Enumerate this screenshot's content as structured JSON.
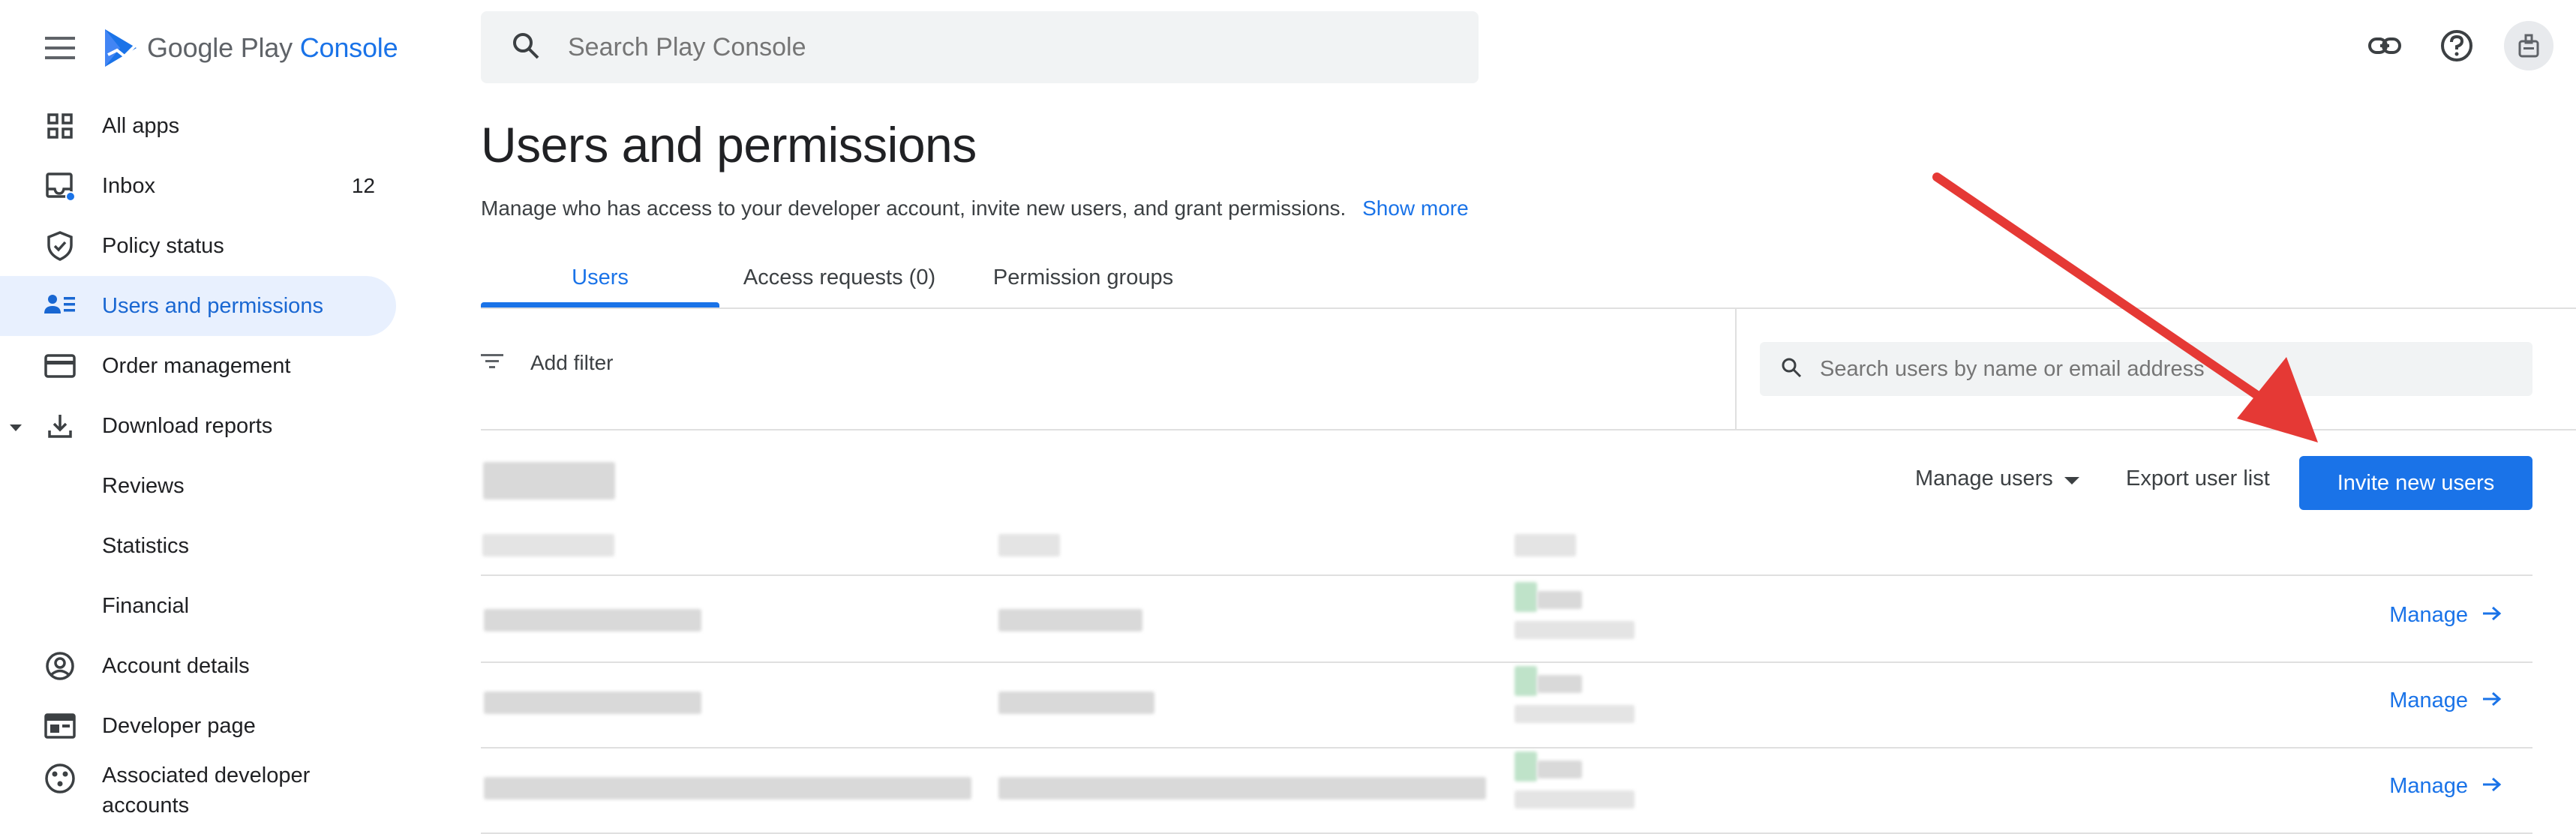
{
  "header": {
    "logo_text_primary": "Google Play",
    "logo_text_secondary": "Console",
    "search_placeholder": "Search Play Console"
  },
  "sidebar": {
    "items": [
      {
        "label": "All apps",
        "icon": "grid-icon"
      },
      {
        "label": "Inbox",
        "icon": "inbox-icon",
        "badge": "12"
      },
      {
        "label": "Policy status",
        "icon": "shield-icon"
      },
      {
        "label": "Users and permissions",
        "icon": "users-icon",
        "active": true
      },
      {
        "label": "Order management",
        "icon": "credit-card-icon"
      },
      {
        "label": "Download reports",
        "icon": "download-icon",
        "expanded": true
      },
      {
        "label": "Reviews",
        "sub": true
      },
      {
        "label": "Statistics",
        "sub": true
      },
      {
        "label": "Financial",
        "sub": true
      },
      {
        "label": "Account details",
        "icon": "account-circle-icon"
      },
      {
        "label": "Developer page",
        "icon": "web-page-icon"
      },
      {
        "label": "Associated developer accounts",
        "icon": "linked-accounts-icon"
      }
    ]
  },
  "main": {
    "title": "Users and permissions",
    "description": "Manage who has access to your developer account, invite new users, and grant permissions.",
    "show_more": "Show more",
    "tabs": [
      {
        "label": "Users",
        "active": true
      },
      {
        "label": "Access requests (0)"
      },
      {
        "label": "Permission groups"
      }
    ],
    "filter": {
      "label": "Add filter"
    },
    "user_search_placeholder": "Search users by name or email address",
    "toolbar": {
      "manage_users": "Manage users",
      "export": "Export user list",
      "invite": "Invite new users"
    },
    "rows": [
      {
        "manage_label": "Manage"
      },
      {
        "manage_label": "Manage"
      },
      {
        "manage_label": "Manage"
      }
    ]
  },
  "colors": {
    "accent": "#1a73e8",
    "active_nav_bg": "#e8f0fe",
    "annotation_arrow": "#e53935"
  }
}
